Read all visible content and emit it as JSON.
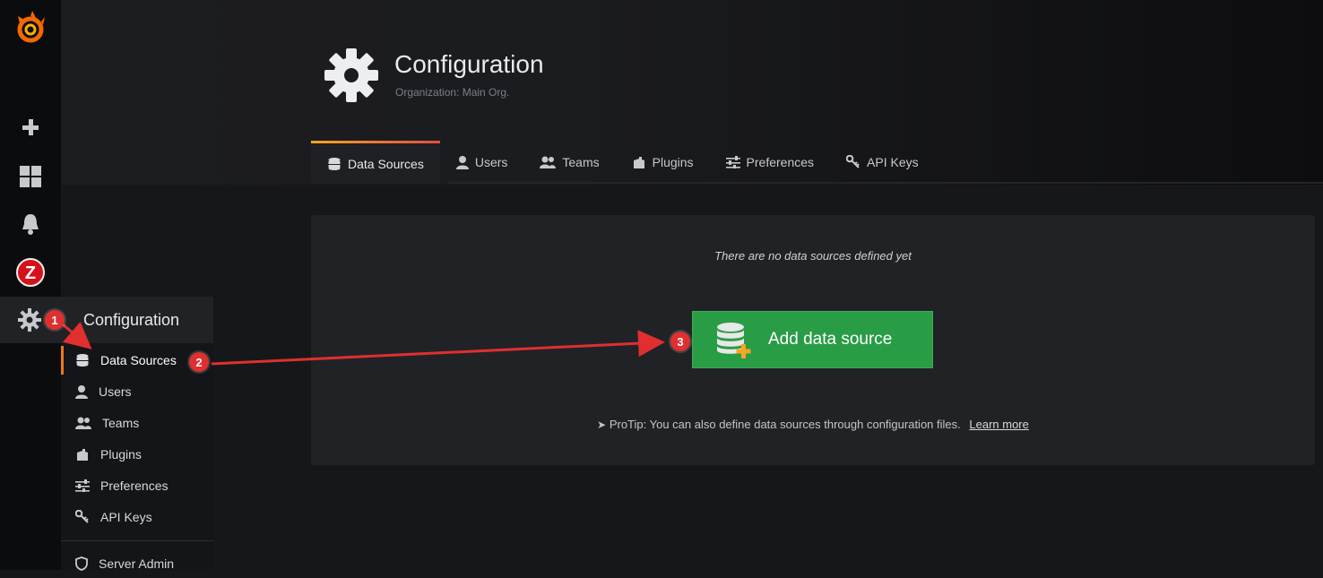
{
  "page": {
    "title": "Configuration",
    "subtitle": "Organization: Main Org."
  },
  "tabs": [
    {
      "label": "Data Sources",
      "icon": "database-icon"
    },
    {
      "label": "Users",
      "icon": "user-icon"
    },
    {
      "label": "Teams",
      "icon": "team-icon"
    },
    {
      "label": "Plugins",
      "icon": "plugin-icon"
    },
    {
      "label": "Preferences",
      "icon": "sliders-icon"
    },
    {
      "label": "API Keys",
      "icon": "key-icon"
    }
  ],
  "panel": {
    "empty_message": "There are no data sources defined yet",
    "add_button_label": "Add data source",
    "protip_text": "ProTip: You can also define data sources through configuration files.",
    "protip_link": "Learn more"
  },
  "sidebar": {
    "logo_icon": "grafana-logo-icon",
    "items": [
      "plus-icon",
      "dashboards-icon",
      "bell-icon",
      "zabbix-icon",
      "gear-icon"
    ],
    "zabbix_letter": "Z"
  },
  "flyout": {
    "header": "Configuration",
    "items": [
      {
        "label": "Data Sources",
        "icon": "database-icon"
      },
      {
        "label": "Users",
        "icon": "user-icon"
      },
      {
        "label": "Teams",
        "icon": "team-icon"
      },
      {
        "label": "Plugins",
        "icon": "plugin-icon"
      },
      {
        "label": "Preferences",
        "icon": "sliders-icon"
      },
      {
        "label": "API Keys",
        "icon": "key-icon"
      },
      {
        "label": "Server Admin",
        "icon": "shield-icon"
      }
    ]
  },
  "annotations": {
    "step1": "1",
    "step2": "2",
    "step3": "3"
  },
  "colors": {
    "accent": "#eb7b18",
    "button": "#299c46",
    "annotation": "#e02f2f"
  }
}
